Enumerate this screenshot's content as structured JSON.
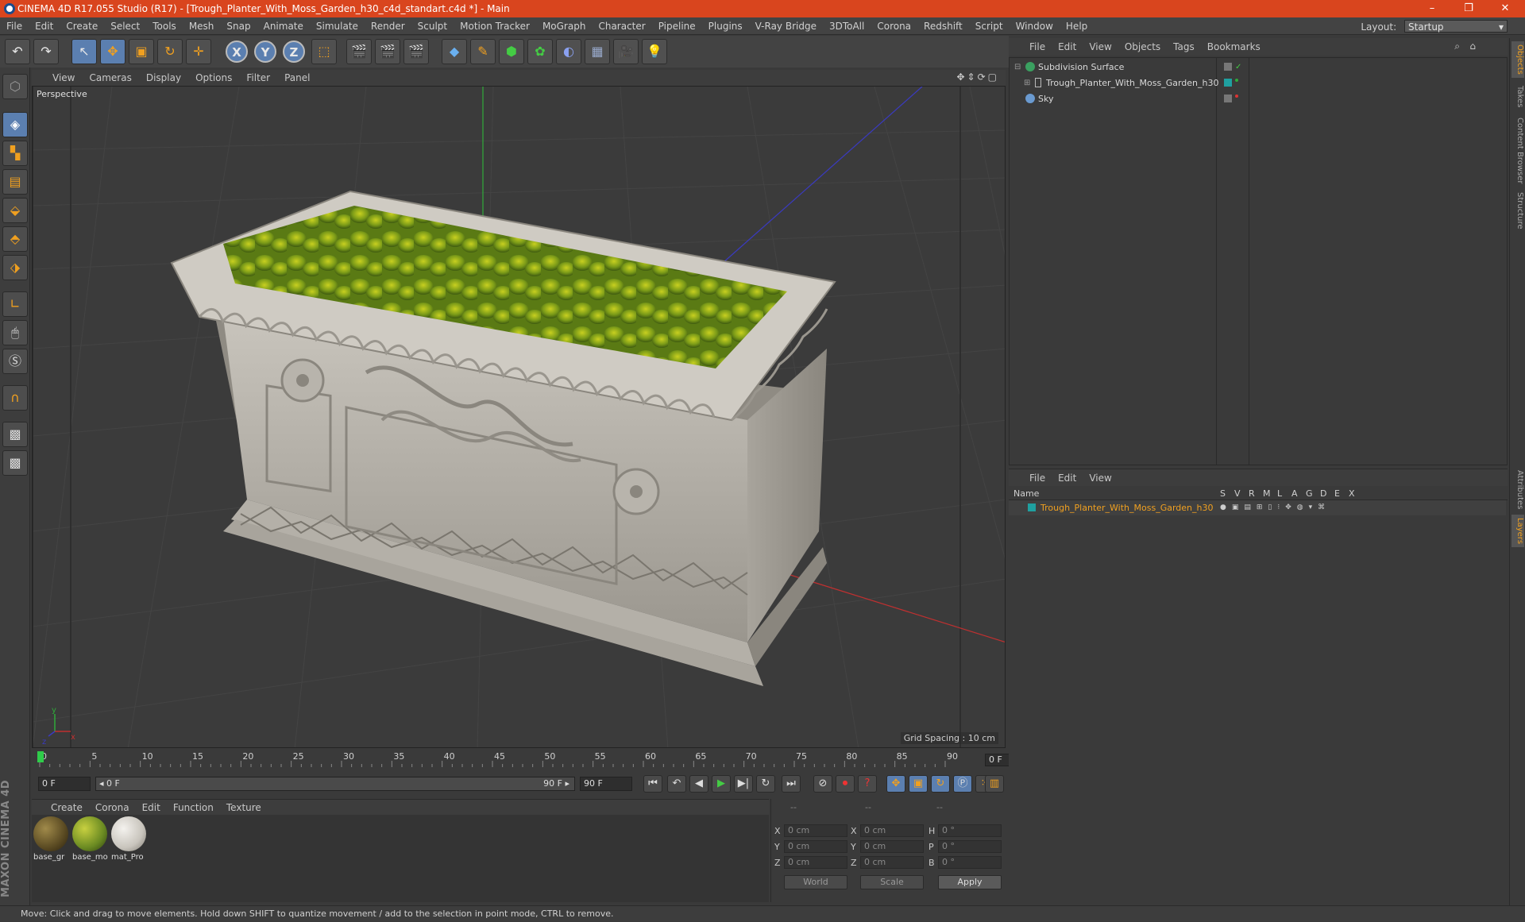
{
  "window": {
    "title": "CINEMA 4D R17.055 Studio (R17) - [Trough_Planter_With_Moss_Garden_h30_c4d_standart.c4d *] - Main",
    "minimize": "–",
    "restore": "❐",
    "close": "✕"
  },
  "menubar": {
    "items": [
      "File",
      "Edit",
      "Create",
      "Select",
      "Tools",
      "Mesh",
      "Snap",
      "Animate",
      "Simulate",
      "Render",
      "Sculpt",
      "Motion Tracker",
      "MoGraph",
      "Character",
      "Pipeline",
      "Plugins",
      "V-Ray Bridge",
      "3DToAll",
      "Corona",
      "Redshift",
      "Script",
      "Window",
      "Help"
    ],
    "layout_label": "Layout:",
    "layout_value": "Startup"
  },
  "toolbar": {
    "undo": "↶",
    "redo": "↷",
    "select": "↖",
    "move": "✥",
    "scale": "▣",
    "rotate": "↻",
    "transform": "✛",
    "axis_x": "X",
    "axis_y": "Y",
    "axis_z": "Z",
    "coord": "⬚"
  },
  "viewport": {
    "menu": [
      "View",
      "Cameras",
      "Display",
      "Options",
      "Filter",
      "Panel"
    ],
    "label": "Perspective",
    "grid_spacing": "Grid Spacing : 10 cm",
    "nav_icons": "✥⇕⟳▢",
    "gizmo": {
      "y": "y",
      "x": "x",
      "z": "z"
    }
  },
  "timeline": {
    "ticks": [
      "0",
      "5",
      "10",
      "15",
      "20",
      "25",
      "30",
      "35",
      "40",
      "45",
      "50",
      "55",
      "60",
      "65",
      "70",
      "75",
      "80",
      "85",
      "90"
    ],
    "current_frame": "0 F"
  },
  "transport": {
    "start": "0 F",
    "range_start": "◂ 0 F",
    "range_end": "90 F ▸",
    "end": "90 F",
    "icons": {
      "first": "⏮",
      "prev_key": "↶",
      "prev": "◀",
      "play": "▶",
      "next": "▶|",
      "loop": "↻",
      "last": "⏭"
    }
  },
  "materials": {
    "menu": [
      "Create",
      "Corona",
      "Edit",
      "Function",
      "Texture"
    ],
    "items": [
      {
        "name": "base_gr",
        "color": "#5a4a22"
      },
      {
        "name": "base_mo",
        "color": "#6a8a22"
      },
      {
        "name": "mat_Pro",
        "color": "#c8c4bc"
      }
    ]
  },
  "coordinates": {
    "header": [
      "--",
      "--",
      "--"
    ],
    "rows": [
      {
        "a": "X",
        "av": "0 cm",
        "b": "X",
        "bv": "0 cm",
        "c": "H",
        "cv": "0 °"
      },
      {
        "a": "Y",
        "av": "0 cm",
        "b": "Y",
        "bv": "0 cm",
        "c": "P",
        "cv": "0 °"
      },
      {
        "a": "Z",
        "av": "0 cm",
        "b": "Z",
        "bv": "0 cm",
        "c": "B",
        "cv": "0 °"
      }
    ],
    "mode1": "World",
    "mode2": "Scale",
    "apply": "Apply"
  },
  "objects": {
    "menu": [
      "File",
      "Edit",
      "View",
      "Objects",
      "Tags",
      "Bookmarks"
    ],
    "items": [
      {
        "name": "Subdivision Surface",
        "icon_color": "#3aa060"
      },
      {
        "name": "Trough_Planter_With_Moss_Garden_h30",
        "icon_color": "#888888"
      },
      {
        "name": "Sky",
        "icon_color": "#6a9ad0"
      }
    ]
  },
  "layers": {
    "menu": [
      "File",
      "Edit",
      "View"
    ],
    "columns": [
      "Name",
      "S",
      "V",
      "R",
      "M",
      "L",
      "A",
      "G",
      "D",
      "E",
      "X"
    ],
    "items": [
      {
        "name": "Trough_Planter_With_Moss_Garden_h30",
        "color": "#1fa0a0"
      }
    ]
  },
  "right_tabs": [
    "Objects",
    "Takes",
    "Content Browser",
    "Structure",
    "Attributes",
    "Layers"
  ],
  "status": "Move: Click and drag to move elements. Hold down SHIFT to quantize movement / add to the selection in point mode, CTRL to remove.",
  "brand": "MAXON CINEMA 4D",
  "colors": {
    "title_bar": "#d9451e",
    "accent_blue": "#5b7fb0",
    "accent_orange": "#f0a020",
    "layer_name": "#f0a020"
  }
}
